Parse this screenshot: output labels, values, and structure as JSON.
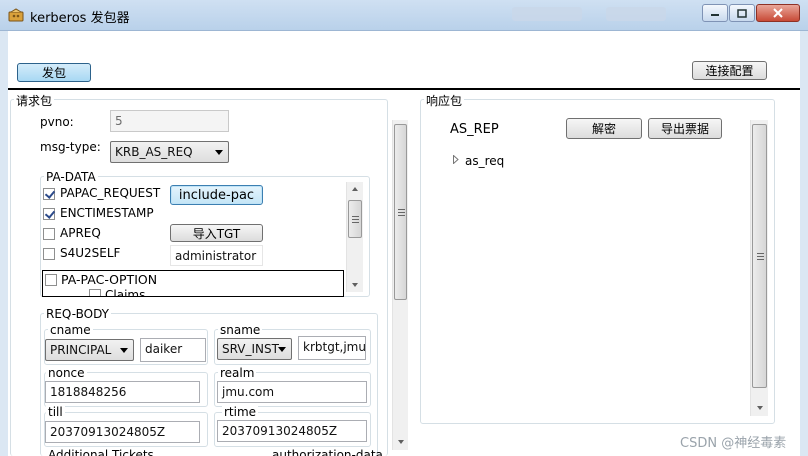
{
  "window": {
    "title": "kerberos 发包器"
  },
  "toolbar": {
    "send_label": "发包",
    "conn_config_label": "连接配置"
  },
  "request": {
    "group_label": "请求包",
    "pvno_label": "pvno:",
    "pvno_value": "5",
    "msg_type_label": "msg-type:",
    "msg_type_value": "KRB_AS_REQ",
    "pa_data": {
      "group_label": "PA-DATA",
      "items": [
        {
          "label": "PAPAC_REQUEST",
          "checked": true
        },
        {
          "label": "ENCTIMESTAMP",
          "checked": true
        },
        {
          "label": "APREQ",
          "checked": false
        },
        {
          "label": "S4U2SELF",
          "checked": false
        },
        {
          "label": "PA-PAC-OPTION",
          "checked": false
        }
      ],
      "sub_option_partial": "Claims",
      "include_pac_label": "include-pac",
      "import_tgt_label": "导入TGT",
      "s4u_user_value": "administrator"
    },
    "req_body": {
      "group_label": "REQ-BODY",
      "cname_label": "cname",
      "cname_type": "PRINCIPAL",
      "cname_value": "daiker",
      "sname_label": "sname",
      "sname_type": "SRV_INST",
      "sname_value": "krbtgt,jmu",
      "nonce_label": "nonce",
      "nonce_value": "1818848256",
      "realm_label": "realm",
      "realm_value": "jmu.com",
      "till_label": "till",
      "till_value": "20370913024805Z",
      "rtime_label": "rtime",
      "rtime_value": "20370913024805Z",
      "additional_tickets_partial": "Additional Tickets",
      "authorization_partial": "authorization-data"
    }
  },
  "response": {
    "group_label": "响应包",
    "type_label": "AS_REP",
    "decrypt_label": "解密",
    "export_ticket_label": "导出票据",
    "tree_root": "as_req"
  },
  "watermark": "CSDN @神经毒素"
}
